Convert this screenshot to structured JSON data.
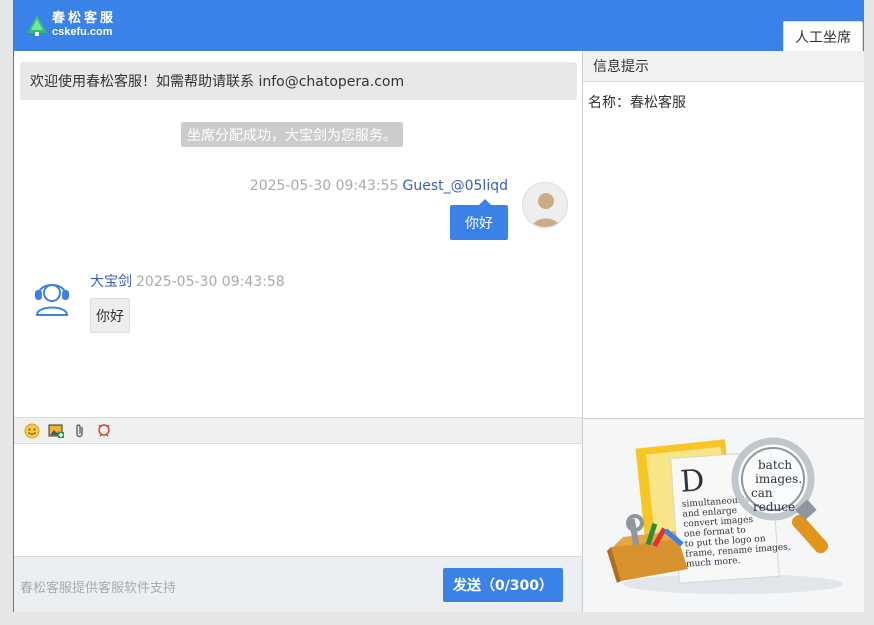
{
  "header": {
    "logo_cn": "春松客服",
    "logo_en": "cskefu.com",
    "tab_agent": "人工坐席"
  },
  "chat": {
    "welcome": "欢迎使用春松客服！如需帮助请联系 info@chatopera.com",
    "system": "坐席分配成功，大宝剑为您服务。",
    "messages": [
      {
        "side": "right",
        "time": "2025-05-30 09:43:55",
        "name": "Guest_@05liqd",
        "text": "你好"
      },
      {
        "side": "left",
        "name": "大宝剑",
        "time": "2025-05-30 09:43:58",
        "text": "你好"
      }
    ]
  },
  "toolbar": {
    "icons": [
      "emoji-icon",
      "image-upload-icon",
      "attachment-icon",
      "rate-icon"
    ]
  },
  "footer": {
    "support_text": "春松客服提供客服软件支持",
    "send_label": "发送（0/300）"
  },
  "info": {
    "title": "信息提示",
    "name_line": "名称：春松客服"
  },
  "colors": {
    "brand": "#3b82e8",
    "name": "#3b5fb6",
    "time": "#aaaaaa"
  }
}
